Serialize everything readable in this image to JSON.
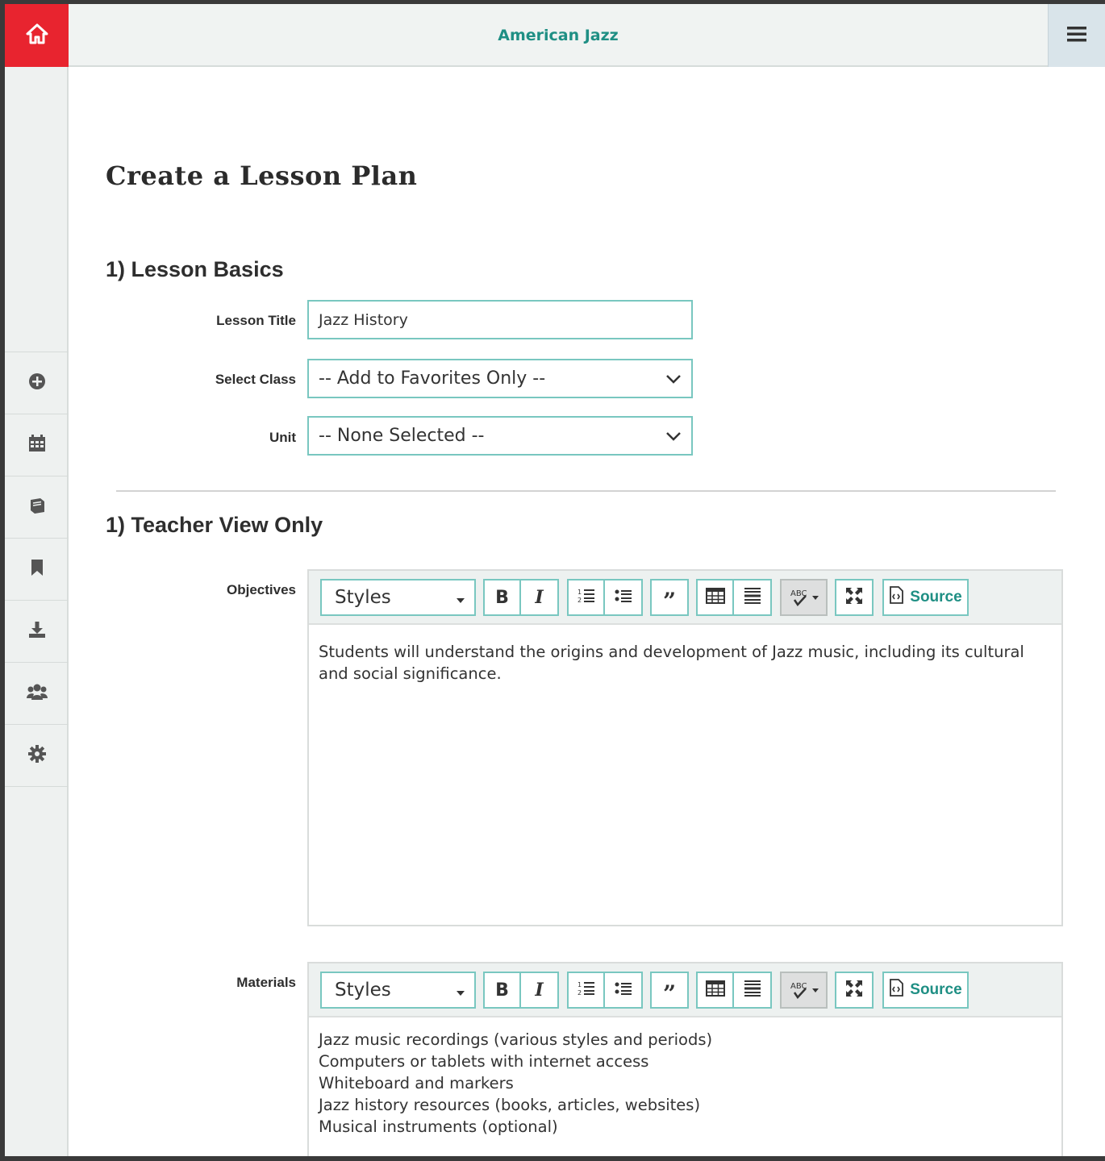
{
  "app": {
    "title": "American Jazz",
    "accent_color": "#e8242f",
    "brand_color": "#1f8f84",
    "icons": {
      "home": "home-icon",
      "menu": "hamburger-menu-icon"
    }
  },
  "sidebar": {
    "items": [
      {
        "name": "add",
        "icon": "plus-circle-icon"
      },
      {
        "name": "calendar",
        "icon": "calendar-icon"
      },
      {
        "name": "book",
        "icon": "book-icon"
      },
      {
        "name": "bookmark",
        "icon": "bookmark-icon"
      },
      {
        "name": "download",
        "icon": "download-icon"
      },
      {
        "name": "users",
        "icon": "users-icon"
      },
      {
        "name": "settings",
        "icon": "gear-icon"
      }
    ]
  },
  "page": {
    "title": "Create a Lesson Plan"
  },
  "basics": {
    "heading": "1) Lesson Basics",
    "lesson_title_label": "Lesson Title",
    "lesson_title_value": "Jazz History",
    "select_class_label": "Select Class",
    "select_class_value": "-- Add to Favorites Only --",
    "unit_label": "Unit",
    "unit_value": "-- None Selected --"
  },
  "teacher_view": {
    "heading": "1) Teacher View Only"
  },
  "editor_toolbar": {
    "styles_label": "Styles",
    "source_label": "Source",
    "spellcheck_text": "ABC"
  },
  "objectives": {
    "label": "Objectives",
    "lines": [
      "Students will understand the origins and development of Jazz music, including its cultural",
      "and social significance."
    ]
  },
  "materials": {
    "label": "Materials",
    "lines": [
      "Jazz music recordings (various styles and periods)",
      "Computers or tablets with internet access",
      "Whiteboard and markers",
      "Jazz history resources (books, articles, websites)",
      "Musical instruments (optional)"
    ]
  }
}
